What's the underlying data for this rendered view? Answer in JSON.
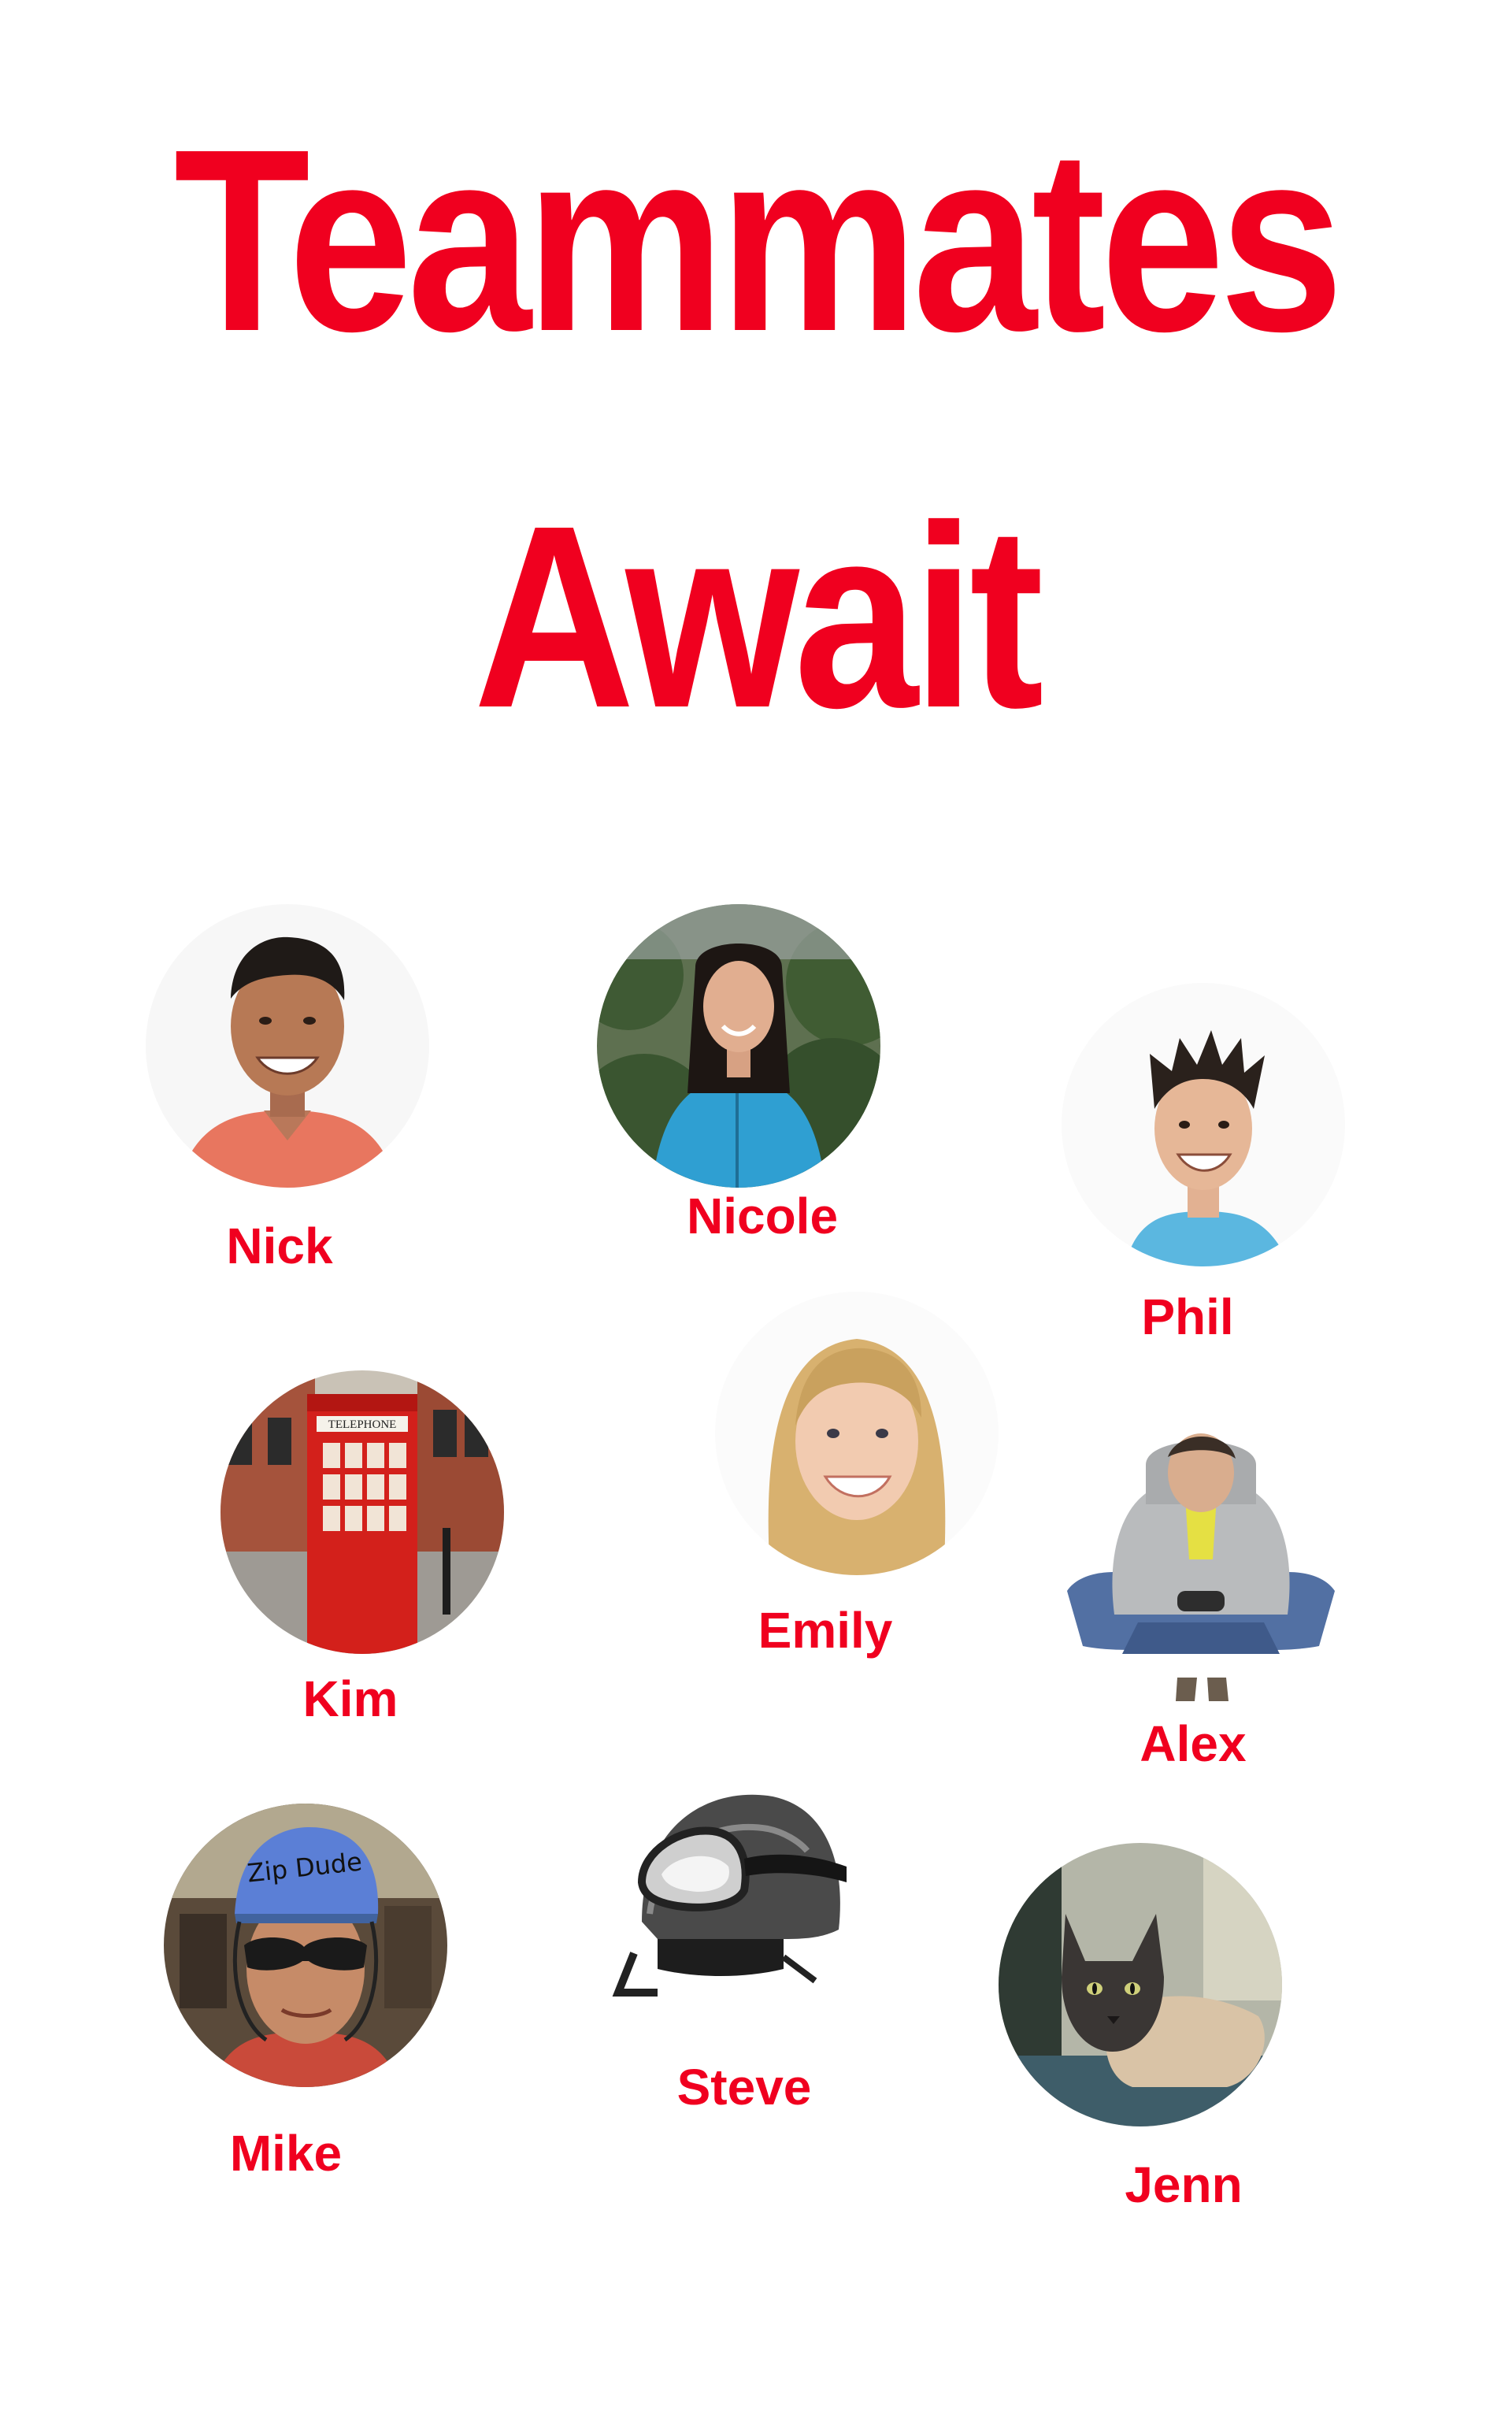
{
  "title": {
    "line1": "Teammates",
    "line2": "Await"
  },
  "colors": {
    "accent": "#f0001f",
    "background": "#ffffff"
  },
  "teammates": [
    {
      "name": "Nick",
      "photo": "smiling young man in coral shirt"
    },
    {
      "name": "Nicole",
      "photo": "woman in blue hoodie in front of trees"
    },
    {
      "name": "Phil",
      "photo": "smiling young man with spiky hair"
    },
    {
      "name": "Kim",
      "photo": "red telephone box on a street"
    },
    {
      "name": "Emily",
      "photo": "smiling blonde young woman"
    },
    {
      "name": "Alex",
      "photo": "young man sitting cross-legged holding a game controller"
    },
    {
      "name": "Mike",
      "photo": "man in blue climbing helmet and sunglasses"
    },
    {
      "name": "Steve",
      "photo": "black ski helmet with goggles"
    },
    {
      "name": "Jenn",
      "photo": "siamese cat lying down"
    }
  ],
  "helmet_sticker": "Zip Dude",
  "phone_box_sign": "TELEPHONE"
}
